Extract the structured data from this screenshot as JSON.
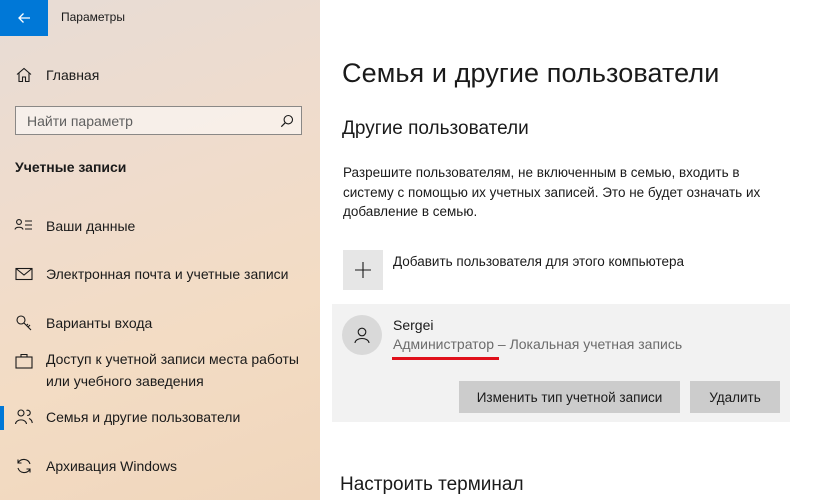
{
  "window": {
    "title": "Параметры"
  },
  "sidebar": {
    "home_label": "Главная",
    "search_placeholder": "Найти параметр",
    "section_label": "Учетные записи",
    "items": [
      {
        "label": "Ваши данные",
        "icon": "person-card-icon"
      },
      {
        "label": "Электронная почта и учетные записи",
        "icon": "mail-icon"
      },
      {
        "label": "Варианты входа",
        "icon": "key-icon"
      },
      {
        "label": "Доступ к учетной записи места работы или учебного заведения",
        "icon": "briefcase-icon"
      },
      {
        "label": "Семья и другие пользователи",
        "icon": "people-icon",
        "active": true
      },
      {
        "label": "Архивация Windows",
        "icon": "sync-icon"
      }
    ]
  },
  "main": {
    "page_title": "Семья и другие пользователи",
    "section_title": "Другие пользователи",
    "description": "Разрешите пользователям, не включенным в семью, входить в систему с помощью их учетных записей. Это не будет означать их добавление в семью.",
    "add_user_label": "Добавить пользователя для этого компьютера",
    "user": {
      "name": "Sergei",
      "role": "Администратор – Локальная учетная запись"
    },
    "change_type_button": "Изменить тип учетной записи",
    "delete_button": "Удалить",
    "terminal_title": "Настроить терминал"
  },
  "colors": {
    "accent": "#0078d7",
    "highlight_underline": "#e0101b",
    "card_bg": "#f2f2f2",
    "button_bg": "#cccccc"
  }
}
